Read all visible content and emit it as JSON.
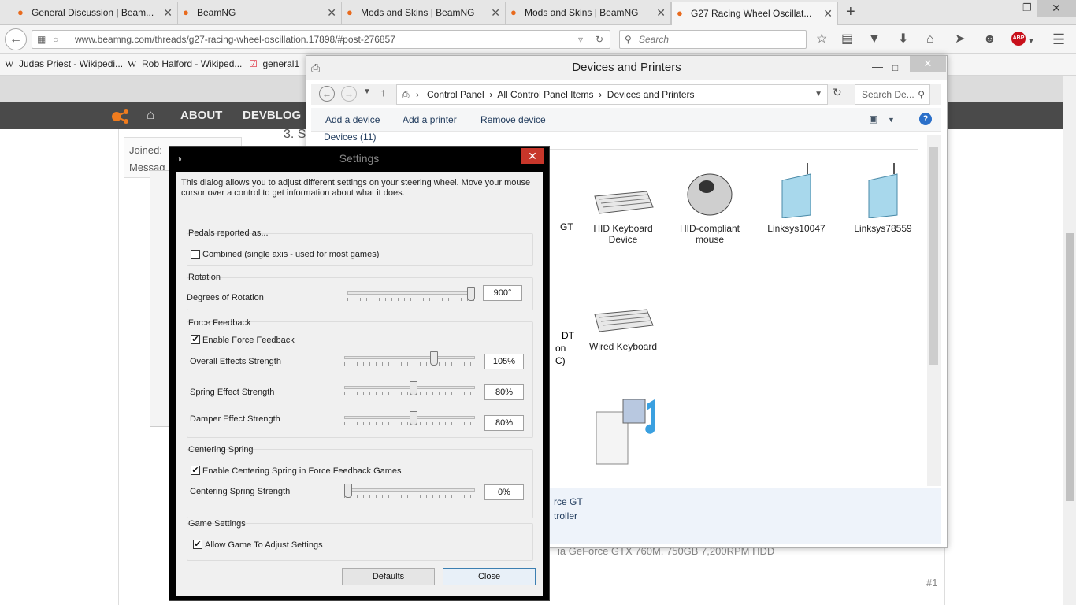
{
  "browser": {
    "tabs": [
      {
        "title": "General Discussion | Beam..."
      },
      {
        "title": "BeamNG"
      },
      {
        "title": "Mods and Skins | BeamNG"
      },
      {
        "title": "Mods and Skins | BeamNG"
      },
      {
        "title": "G27 Racing Wheel Oscillat..."
      }
    ],
    "url": "www.beamng.com/threads/g27-racing-wheel-oscillation.17898/#post-276857",
    "search_placeholder": "Search",
    "bookmarks": [
      {
        "label": "Judas Priest - Wikipedi..."
      },
      {
        "label": "Rob Halford - Wikiped..."
      },
      {
        "label": "general1"
      }
    ],
    "abp_label": "ABP"
  },
  "site": {
    "nav": [
      "ABOUT",
      "DEVBLOG"
    ],
    "fragments": {
      "joined": "Joined:",
      "message": "Messag",
      "heading_frag": "3. S",
      "specs_frag": "ia GeForce GTX 760M, 750GB 7,200RPM HDD",
      "post_num": "#1"
    }
  },
  "explorer": {
    "title": "Devices and Printers",
    "breadcrumbs": [
      "Control Panel",
      "All Control Panel Items",
      "Devices and Printers"
    ],
    "search_placeholder": "Search De...",
    "commands": [
      "Add a device",
      "Add a printer",
      "Remove device"
    ],
    "section_header": "Devices (11)",
    "devices": [
      {
        "label": "HID Keyboard Device"
      },
      {
        "label": "HID-compliant mouse"
      },
      {
        "label": "Linksys10047"
      },
      {
        "label": "Linksys78559"
      },
      {
        "label": "Wired Keyboard"
      }
    ],
    "partial_labels": {
      "gt": "GT",
      "dt1": "DT",
      "dt2": "on",
      "dt3": "C)"
    },
    "details": {
      "line1": "rce GT",
      "line2": "troller"
    }
  },
  "settings": {
    "title": "Settings",
    "intro": "This dialog allows you to adjust different settings on your steering wheel.  Move your mouse cursor over a control to get information about what it does.",
    "pedals": {
      "title": "Pedals reported as...",
      "combined_label": "Combined (single axis - used for most games)",
      "combined_checked": false
    },
    "rotation": {
      "title": "Rotation",
      "label": "Degrees of Rotation",
      "value_text": "900°",
      "fraction": 1.0
    },
    "force_feedback": {
      "title": "Force Feedback",
      "enable_label": "Enable Force Feedback",
      "enable_checked": true,
      "overall_label": "Overall Effects Strength",
      "overall_value": "105%",
      "overall_fraction": 0.7,
      "spring_label": "Spring Effect Strength",
      "spring_value": "80%",
      "spring_fraction": 0.53,
      "damper_label": "Damper Effect Strength",
      "damper_value": "80%",
      "damper_fraction": 0.53
    },
    "centering": {
      "title": "Centering Spring",
      "enable_label": "Enable Centering Spring in Force Feedback Games",
      "enable_checked": true,
      "strength_label": "Centering Spring Strength",
      "strength_value": "0%",
      "strength_fraction": 0.0
    },
    "game": {
      "title": "Game Settings",
      "allow_label": "Allow Game To Adjust Settings",
      "allow_checked": true
    },
    "buttons": {
      "defaults": "Defaults",
      "close": "Close"
    }
  }
}
